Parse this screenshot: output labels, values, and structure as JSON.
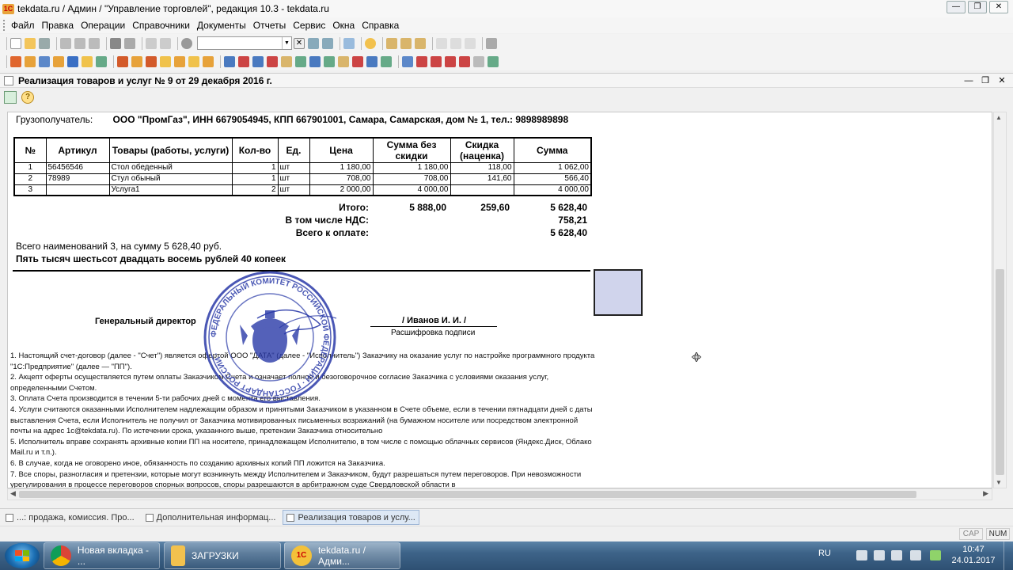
{
  "window": {
    "title": "tekdata.ru / Админ / \"Управление торговлей\", редакция 10.3 - tekdata.ru",
    "app_icon_text": "1С"
  },
  "menu": [
    "Файл",
    "Правка",
    "Операции",
    "Справочники",
    "Документы",
    "Отчеты",
    "Сервис",
    "Окна",
    "Справка"
  ],
  "document": {
    "title": "Реализация товаров и услуг № 9 от 29 декабря 2016 г.",
    "consignee_label": "Грузополучатель:",
    "consignee_value": "ООО \"ПромГаз\", ИНН 6679054945, КПП 667901001, Самара, Самарская, дом № 1, тел.: 9898989898",
    "columns": [
      "№",
      "Артикул",
      "Товары (работы, услуги)",
      "Кол-во",
      "Ед.",
      "Цена",
      "Сумма без скидки",
      "Скидка (наценка)",
      "Сумма"
    ],
    "rows": [
      [
        "1",
        "56456546",
        "Стол обеденный",
        "1",
        "шт",
        "1 180,00",
        "1 180,00",
        "118,00",
        "1 062,00"
      ],
      [
        "2",
        "78989",
        "Стул обыный",
        "1",
        "шт",
        "708,00",
        "708,00",
        "141,60",
        "566,40"
      ],
      [
        "3",
        "",
        "Услуга1",
        "2",
        "шт",
        "2 000,00",
        "4 000,00",
        "",
        "4 000,00"
      ]
    ],
    "totals": {
      "itogo_label": "Итого:",
      "itogo_nodisc": "5 888,00",
      "itogo_disc": "259,60",
      "itogo_sum": "5 628,40",
      "vat_label": "В том числе НДС:",
      "vat_value": "758,21",
      "pay_label": "Всего к оплате:",
      "pay_value": "5 628,40"
    },
    "summary_line": "Всего наименований 3, на сумму 5 628,40 руб.",
    "summary_words": "Пять тысяч шестьсот двадцать восемь рублей 40 копеек",
    "director_label": "Генеральный директор",
    "signer_name": "/ Иванов И. И. /",
    "signature_caption": "Расшифровка подписи",
    "stamp_text": "ФЕДЕРАЛЬНЫЙ КОМИТЕТ РОССИЙСКОЙ ФЕДЕРАЦИИ ПО СТАНДАРТИЗАЦИИ И МЕТРОЛОГИИ (ГОССТАНДАРТ РОССИИ)",
    "terms": [
      "1. Настоящий счет-договор (далее - \"Счет\") является офертой ООО \"ДАТА\" (далее - \"Исполнитель\") Заказчику на оказание услуг по настройке программного продукта \"1С:Предприятие\" (далее — \"ПП\").",
      "2. Акцепт оферты осуществляется путем оплаты Заказчиком Счета и означает полное и безоговорочное согласие Заказчика с условиями оказания услуг, определенными Счетом.",
      "3. Оплата Счета производится в течении 5-ти рабочих дней с момента его выставления.",
      "4. Услуги считаются оказанными Исполнителем надлежащим образом и принятыми Заказчиком в указанном в Счете объеме, если в течении пятнадцати дней с даты выставления Счета, если Исполнитель не получил от Заказчика мотивированных письменных возражаний (на бумажном носителе или посредством электронной почты на адрес 1c@tekdata.ru). По истечении срока, указанного выше, претензии Заказчика относительно",
      "5. Исполнитель вправе сохранять архивные копии ПП на носителе, принадлежащем Исполнителю, в том числе с помощью облачных сервисов (Яндекс.Диск, Облако Mail.ru и т.п.).",
      "6. В случае, когда не оговорено иное, обязанность по созданию архивных копий ПП ложится на Заказчика.",
      "7. Все споры, разногласия и претензии, которые могут возникнуть между Исполнителем и Заказчиком, будут разрешаться путем переговоров. При невозможности урегулирования в процессе переговоров спорных вопросов,  споры разрешаются в арбитражном суде Свердловской области в"
    ]
  },
  "window_tabs": [
    "...: продажа, комиссия. Про...",
    "Дополнительная информац...",
    "Реализация товаров и услу..."
  ],
  "status": {
    "cap": "CAP",
    "num": "NUM"
  },
  "taskbar": {
    "buttons": [
      "Новая вкладка - ...",
      "ЗАГРУЗКИ",
      "tekdata.ru / Адми..."
    ],
    "lang": "RU",
    "time": "10:47",
    "date": "24.01.2017"
  },
  "colors": {
    "stamp": "#2a3aa8",
    "stamp_box": "#d0d4ec",
    "active_tab": "#dde8f5"
  }
}
